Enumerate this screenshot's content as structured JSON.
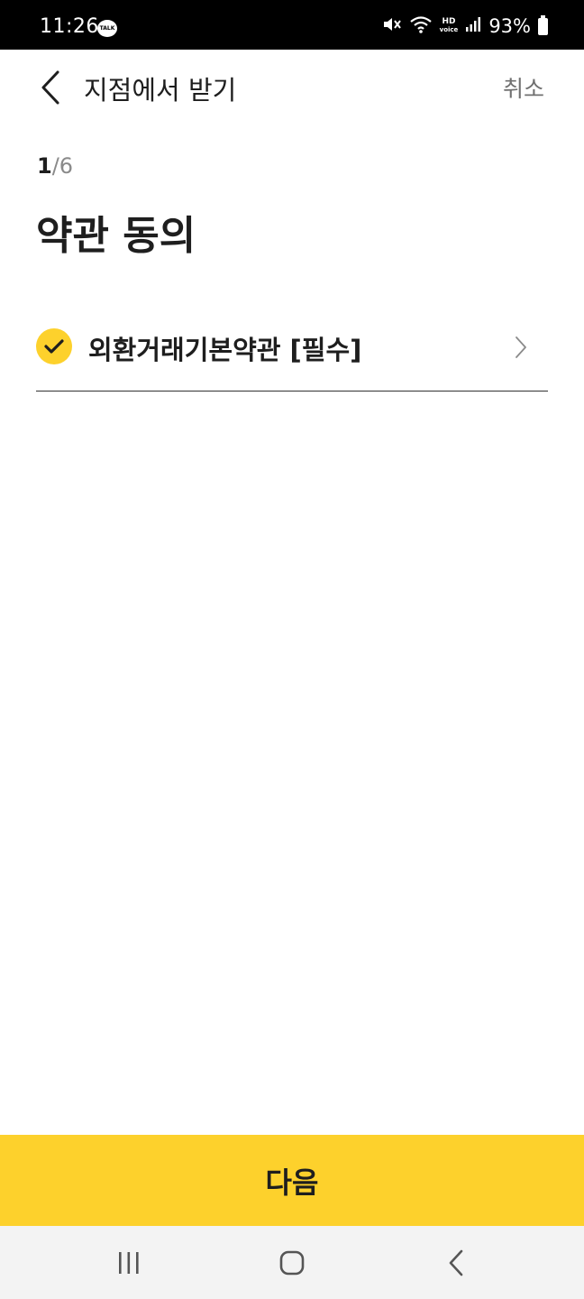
{
  "status_bar": {
    "time": "11:26",
    "talk_badge": "TALK",
    "hd_top": "HD",
    "hd_bottom": "voice",
    "battery": "93%"
  },
  "header": {
    "title": "지점에서 받기",
    "cancel_label": "취소"
  },
  "step": {
    "current": "1",
    "separator": "/",
    "total": "6"
  },
  "page_title": "약관 동의",
  "agreements": [
    {
      "label": "외환거래기본약관 [필수]",
      "checked": true
    }
  ],
  "next_label": "다음",
  "colors": {
    "accent": "#fdd12c",
    "text": "#1e1e1e",
    "muted": "#707070",
    "nav_bg": "#f3f3f3"
  },
  "icons": {
    "back": "chevron-left-icon",
    "check": "check-icon",
    "row_arrow": "chevron-right-icon",
    "nav_recents": "recents-icon",
    "nav_home": "home-icon",
    "nav_back": "back-icon"
  }
}
